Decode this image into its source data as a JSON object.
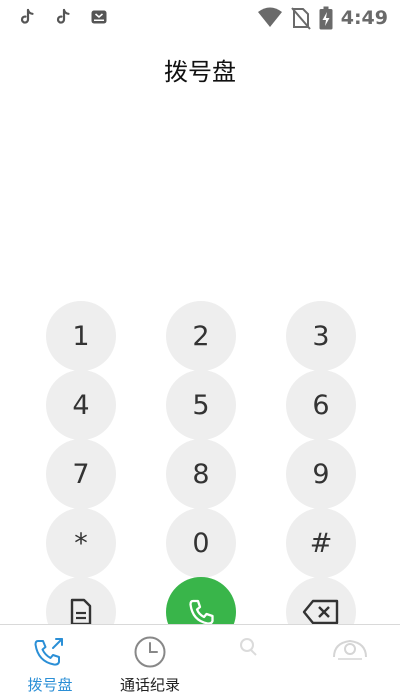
{
  "status_bar": {
    "time": "4:49",
    "left_icons": [
      "tiktok-icon",
      "tiktok-icon",
      "tv-app-icon"
    ],
    "right_icons": [
      "wifi-icon",
      "no-sim-icon",
      "battery-charging-icon"
    ]
  },
  "header": {
    "title": "拨号盘"
  },
  "keypad": {
    "keys": [
      {
        "label": "1"
      },
      {
        "label": "2"
      },
      {
        "label": "3"
      },
      {
        "label": "4"
      },
      {
        "label": "5"
      },
      {
        "label": "6"
      },
      {
        "label": "7"
      },
      {
        "label": "8"
      },
      {
        "label": "9"
      },
      {
        "label": "*"
      },
      {
        "label": "0"
      },
      {
        "label": "#"
      }
    ],
    "actions": [
      "document-icon",
      "phone-call-icon",
      "backspace-icon"
    ],
    "key_color": "#eeeeee",
    "call_color": "#39b54a"
  },
  "bottom_nav": {
    "items": [
      {
        "label": "拨号盘",
        "icon": "dialer-icon",
        "active": true
      },
      {
        "label": "通话纪录",
        "icon": "clock-icon",
        "active": false
      },
      {
        "label": "",
        "icon": "search-icon",
        "active": false
      },
      {
        "label": "",
        "icon": "contacts-icon",
        "active": false
      }
    ],
    "active_color": "#2b8fd6"
  }
}
